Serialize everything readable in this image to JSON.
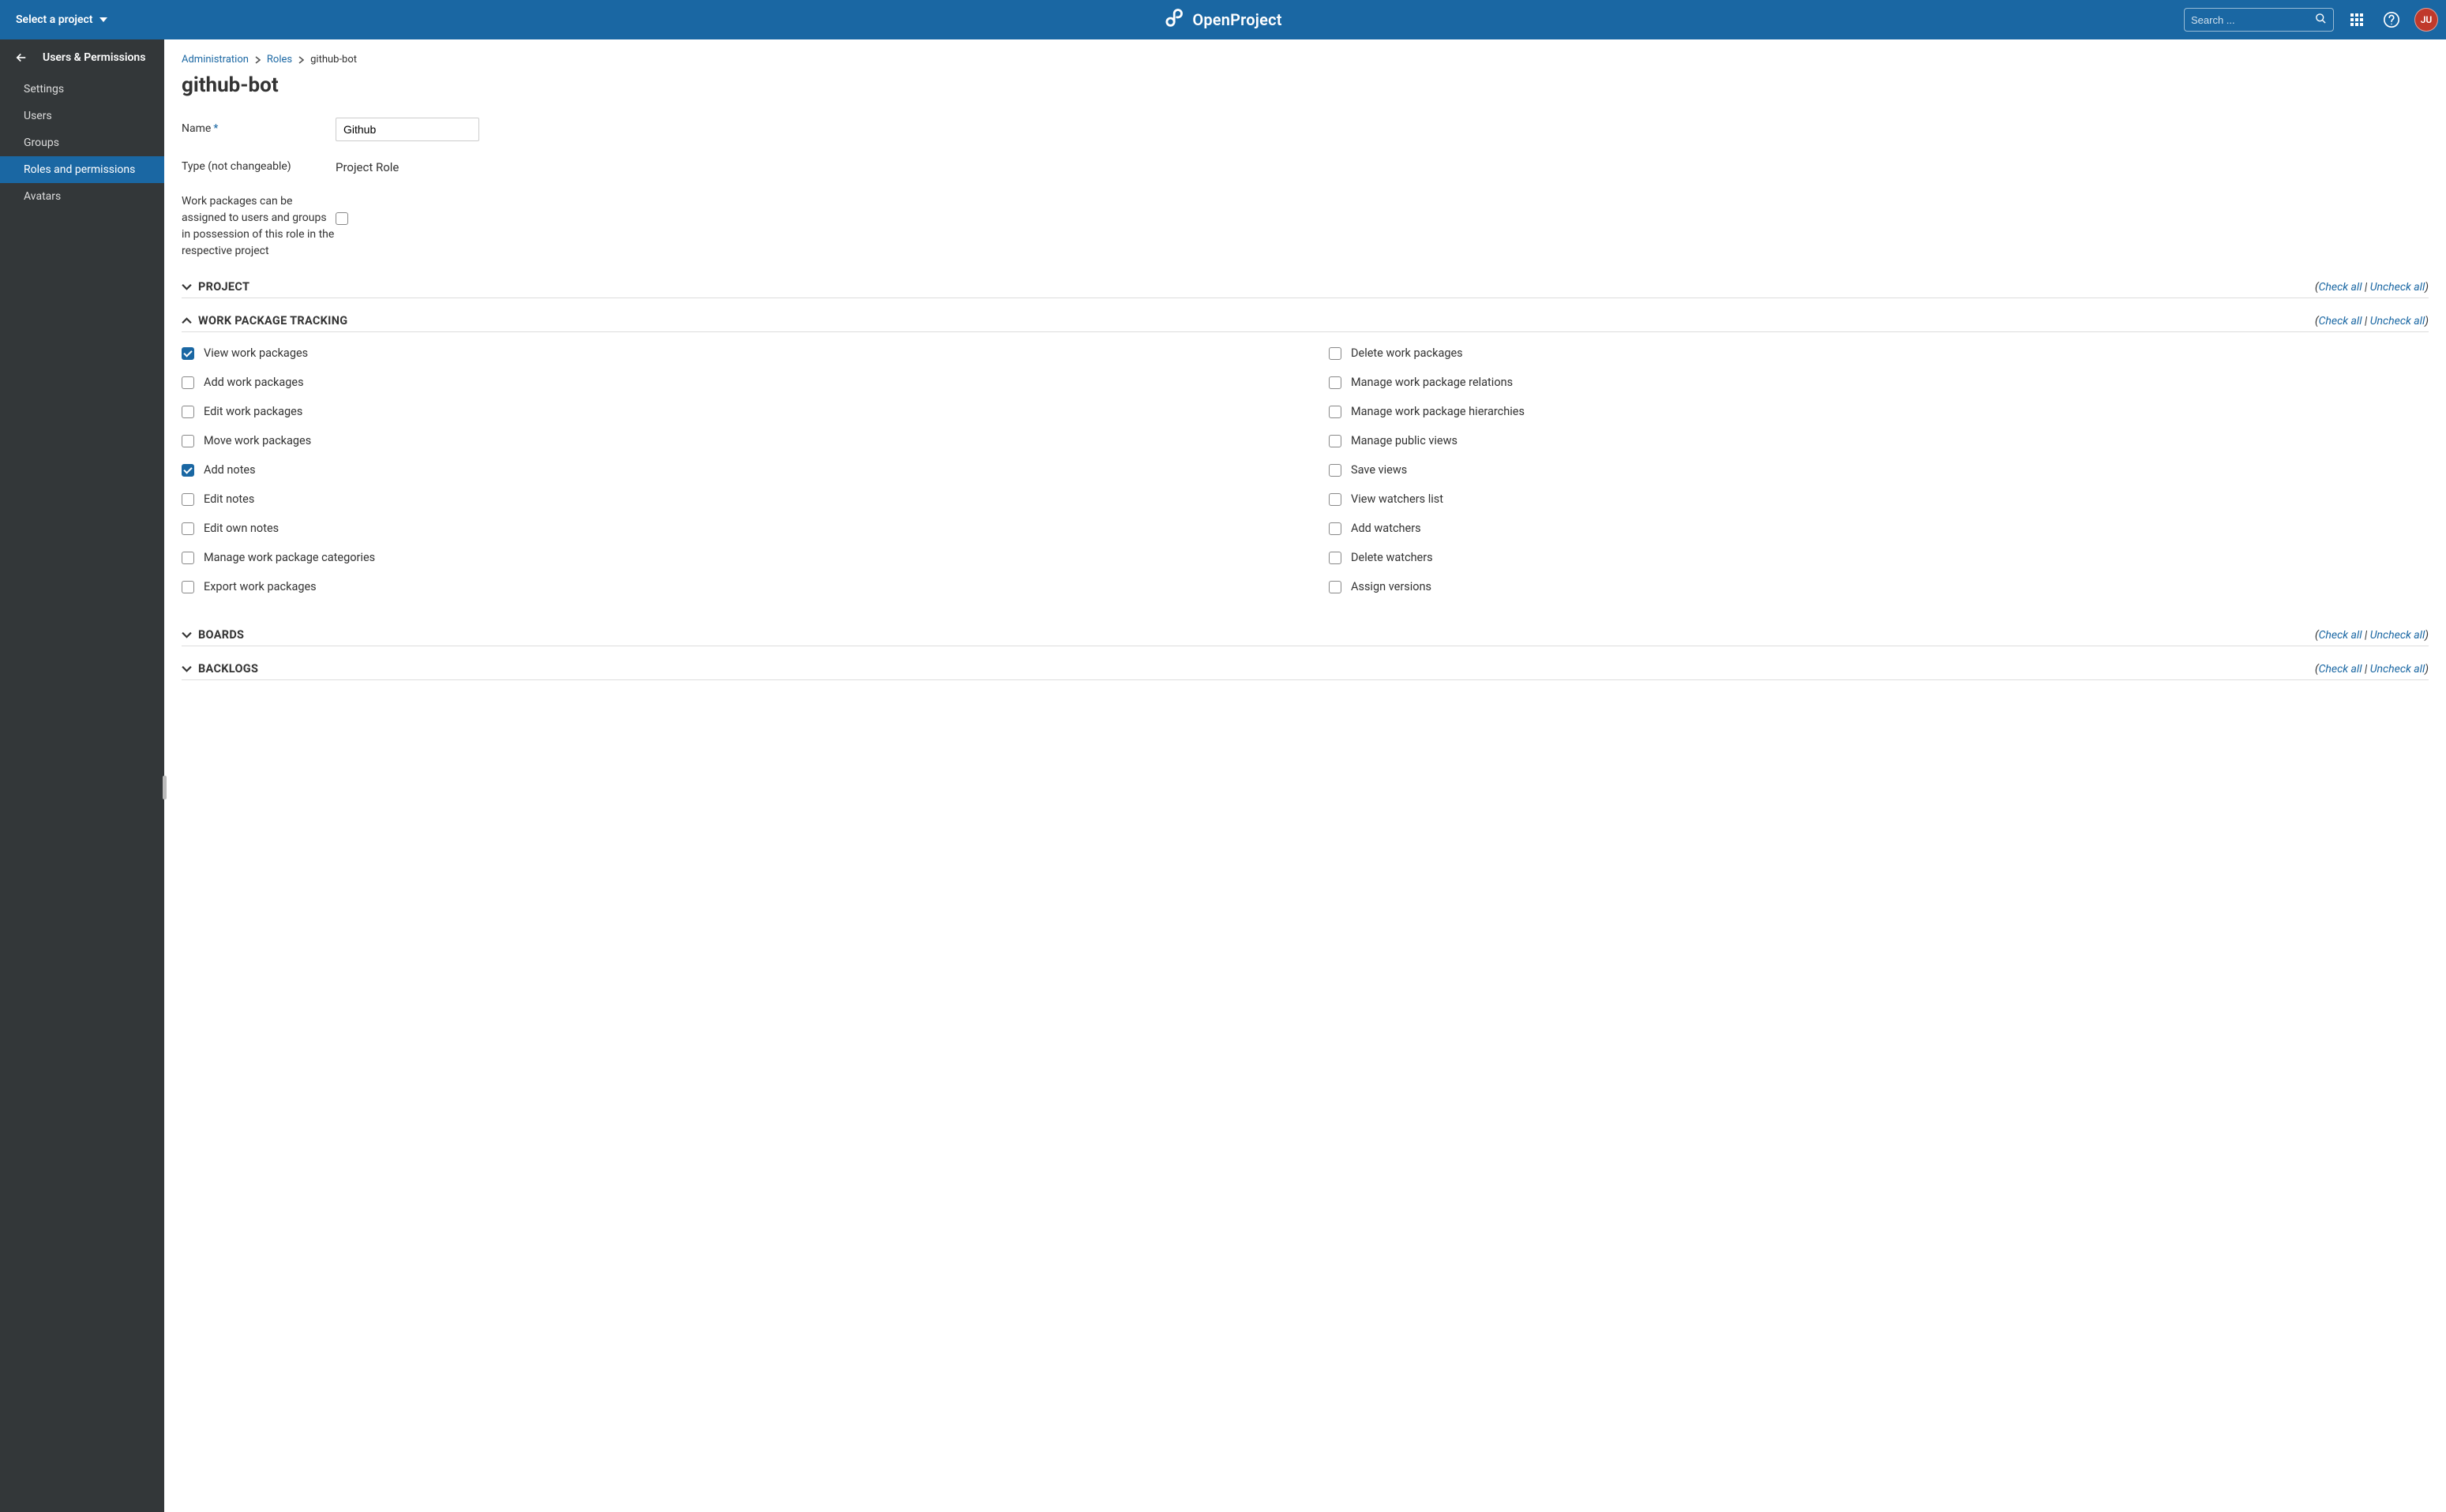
{
  "topbar": {
    "project_selector_label": "Select a project",
    "brand_name": "OpenProject",
    "search_placeholder": "Search ...",
    "avatar_initials": "JU"
  },
  "sidebar": {
    "title": "Users & Permissions",
    "items": [
      {
        "label": "Settings",
        "active": false
      },
      {
        "label": "Users",
        "active": false
      },
      {
        "label": "Groups",
        "active": false
      },
      {
        "label": "Roles and permissions",
        "active": true
      },
      {
        "label": "Avatars",
        "active": false
      }
    ]
  },
  "breadcrumb": {
    "administration": "Administration",
    "roles": "Roles",
    "current": "github-bot"
  },
  "page_title": "github-bot",
  "form": {
    "name_label": "Name",
    "name_value": "Github",
    "type_label": "Type (not changeable)",
    "type_value": "Project Role",
    "wp_assignable_label": "Work packages can be assigned to users and groups in possession of this role in the respective project",
    "wp_assignable_checked": false
  },
  "check_links": {
    "open_paren": "(",
    "check_all": "Check all",
    "sep": " | ",
    "uncheck_all": "Uncheck all",
    "close_paren": ")"
  },
  "sections": [
    {
      "title": "Project",
      "expanded": false,
      "permissions": []
    },
    {
      "title": "Work package tracking",
      "expanded": true,
      "permissions": {
        "left": [
          {
            "label": "View work packages",
            "checked": true
          },
          {
            "label": "Add work packages",
            "checked": false
          },
          {
            "label": "Edit work packages",
            "checked": false
          },
          {
            "label": "Move work packages",
            "checked": false
          },
          {
            "label": "Add notes",
            "checked": true
          },
          {
            "label": "Edit notes",
            "checked": false
          },
          {
            "label": "Edit own notes",
            "checked": false
          },
          {
            "label": "Manage work package categories",
            "checked": false
          },
          {
            "label": "Export work packages",
            "checked": false
          }
        ],
        "right": [
          {
            "label": "Delete work packages",
            "checked": false
          },
          {
            "label": "Manage work package relations",
            "checked": false
          },
          {
            "label": "Manage work package hierarchies",
            "checked": false
          },
          {
            "label": "Manage public views",
            "checked": false
          },
          {
            "label": "Save views",
            "checked": false
          },
          {
            "label": "View watchers list",
            "checked": false
          },
          {
            "label": "Add watchers",
            "checked": false
          },
          {
            "label": "Delete watchers",
            "checked": false
          },
          {
            "label": "Assign versions",
            "checked": false
          }
        ]
      }
    },
    {
      "title": "Boards",
      "expanded": false,
      "permissions": []
    },
    {
      "title": "Backlogs",
      "expanded": false,
      "permissions": []
    }
  ]
}
